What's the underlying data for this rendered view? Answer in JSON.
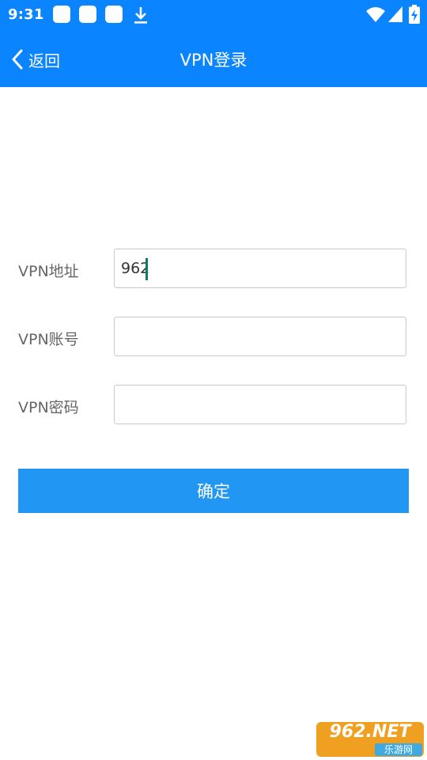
{
  "status_bar": {
    "time": "9:31",
    "icons": [
      "notification-square-icon",
      "notification-square-icon",
      "notification-square-icon",
      "download-icon",
      "wifi-icon",
      "cell-signal-icon",
      "battery-charging-icon"
    ]
  },
  "toolbar": {
    "back_label": "返回",
    "title": "VPN登录",
    "color": "#0a84ff"
  },
  "form": {
    "address": {
      "label": "VPN地址",
      "value": "962"
    },
    "account": {
      "label": "VPN账号",
      "value": ""
    },
    "password": {
      "label": "VPN密码",
      "value": ""
    }
  },
  "confirm_button": {
    "label": "确定",
    "color": "#2196f3"
  },
  "watermark": {
    "main": "962.NET",
    "sub": "乐游网"
  }
}
